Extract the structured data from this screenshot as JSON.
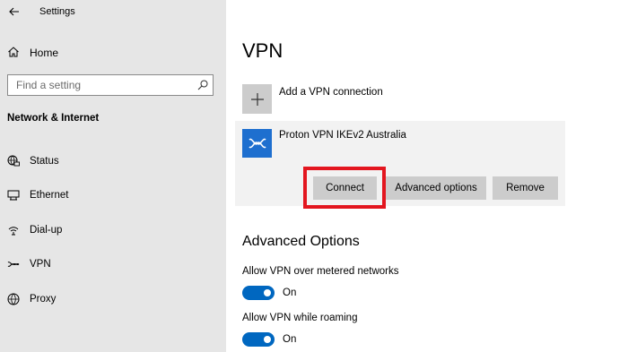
{
  "window": {
    "title": "Settings"
  },
  "sidebar": {
    "home_label": "Home",
    "search_placeholder": "Find a setting",
    "section_title": "Network & Internet",
    "items": [
      {
        "label": "Status",
        "icon": "globe-monitor-icon"
      },
      {
        "label": "Ethernet",
        "icon": "ethernet-icon"
      },
      {
        "label": "Dial-up",
        "icon": "dialup-icon"
      },
      {
        "label": "VPN",
        "icon": "vpn-icon"
      },
      {
        "label": "Proxy",
        "icon": "globe-icon"
      }
    ]
  },
  "main": {
    "title": "VPN",
    "add_connection_label": "Add a VPN connection",
    "connection": {
      "name": "Proton VPN IKEv2 Australia",
      "connect_label": "Connect",
      "advanced_label": "Advanced options",
      "remove_label": "Remove"
    },
    "advanced": {
      "heading": "Advanced Options",
      "settings": [
        {
          "label": "Allow VPN over metered networks",
          "state": "On",
          "on": true
        },
        {
          "label": "Allow VPN while roaming",
          "state": "On",
          "on": true
        }
      ]
    }
  },
  "colors": {
    "accent": "#0067c0",
    "highlight": "#e3161f",
    "vpn_tile": "#1e6fcf"
  }
}
